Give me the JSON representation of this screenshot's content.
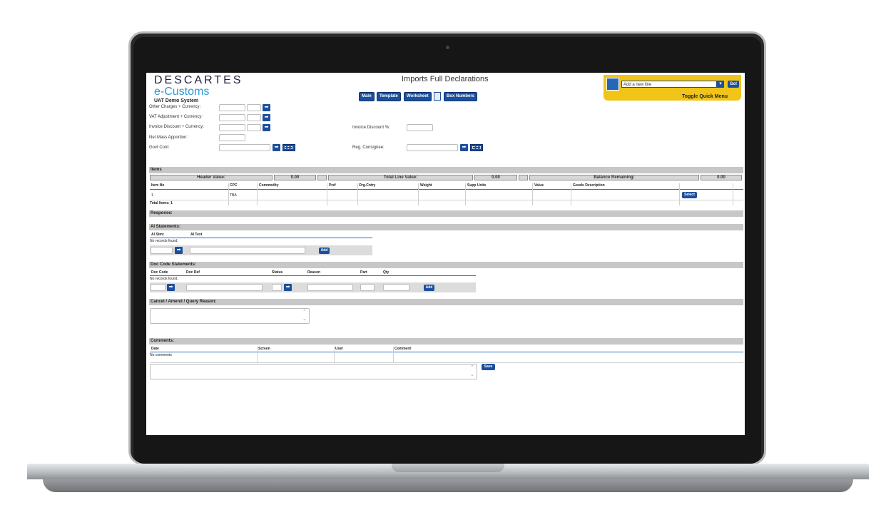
{
  "brand": {
    "logo_top": "DESCARTES",
    "logo_bottom": "e-Customs",
    "system": "UAT Demo System"
  },
  "page_title": "Imports Full Declarations",
  "nav": {
    "main": "Main",
    "template": "Template",
    "worksheet": "Worksheet",
    "box_numbers": "Box Numbers"
  },
  "quick_menu": {
    "select_value": "Add a new line",
    "go": "Go!",
    "toggle": "Toggle Quick Menu"
  },
  "form": {
    "other_charges": "Other Charges + Currency:",
    "vat_adjustment": "VAT Adjustment + Currency:",
    "invoice_discount": "Invoice Discount + Currency:",
    "net_mass": "Net Mass Apportion:",
    "govt_cont": "Govt Cont:",
    "invoice_discount_pct": "Invoice Discount %:",
    "reg_consignee": "Reg. Consignee:"
  },
  "items": {
    "title": "Items",
    "header_value_label": "Header Value:",
    "header_value": "0.00",
    "total_line_label": "Total Line Value:",
    "total_line_value": "0.00",
    "balance_label": "Balance Remaining:",
    "balance_value": "0.00",
    "columns": [
      "Item No",
      "CPC",
      "Commodity",
      "Pref",
      "Org.Cntry",
      "Weight",
      "Supp Units",
      "Value",
      "Goods Description"
    ],
    "row": {
      "item_no": "1",
      "cpc": "TBA",
      "select": "Select"
    },
    "total": "Total Items: 1"
  },
  "response": {
    "title": "Response:"
  },
  "ai": {
    "title": "AI Statements:",
    "col_stmt": "AI Stmt",
    "col_text": "AI Text",
    "empty": "No records found.",
    "add": "Add"
  },
  "doc": {
    "title": "Doc Code Statements:",
    "columns": [
      "Doc Code",
      "Doc Ref",
      "Status",
      "Reason",
      "Part",
      "Qty"
    ],
    "empty": "No records found.",
    "add": "Add"
  },
  "cancel": {
    "title": "Cancel / Amend / Query Reason:"
  },
  "comments": {
    "title": "Comments:",
    "columns": [
      "Date",
      "Screen",
      "User",
      "Comment"
    ],
    "empty": "No comments",
    "save": "Save"
  }
}
